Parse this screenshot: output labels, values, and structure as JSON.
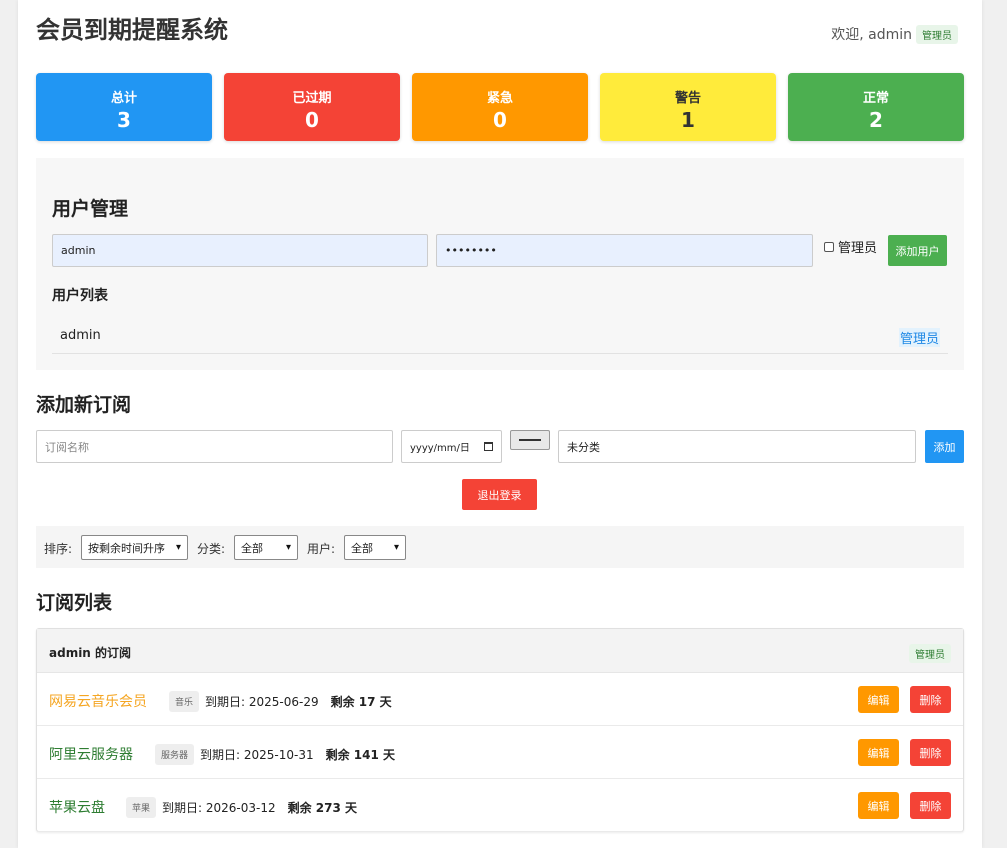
{
  "header": {
    "title": "会员到期提醒系统",
    "welcome": "欢迎, admin",
    "role_badge": "管理员"
  },
  "stats": [
    {
      "label": "总计",
      "value": "3",
      "color": "#2196f3"
    },
    {
      "label": "已过期",
      "value": "0",
      "color": "#f44336"
    },
    {
      "label": "紧急",
      "value": "0",
      "color": "#ff9800"
    },
    {
      "label": "警告",
      "value": "1",
      "color": "#ffeb3b"
    },
    {
      "label": "正常",
      "value": "2",
      "color": "#4caf50"
    }
  ],
  "user_mgmt": {
    "title": "用户管理",
    "username_value": "admin",
    "password_value": "••••••••",
    "admin_checkbox_label": "管理员",
    "add_button": "添加用户",
    "list_title": "用户列表",
    "users": [
      {
        "name": "admin",
        "role": "管理员"
      }
    ]
  },
  "add_sub": {
    "title": "添加新订阅",
    "name_placeholder": "订阅名称",
    "date_placeholder": "yyyy/mm/日",
    "color_button": "",
    "category_value": "未分类",
    "add_button": "添加"
  },
  "logout_button": "退出登录",
  "filters": {
    "sort_label": "排序:",
    "sort_value": "按剩余时间升序",
    "category_label": "分类:",
    "category_value": "全部",
    "user_label": "用户:",
    "user_value": "全部"
  },
  "list": {
    "title": "订阅列表",
    "owner_heading": "admin 的订阅",
    "owner_badge": "管理员",
    "items": [
      {
        "name": "网易云音乐会员",
        "name_color": "#f5a623",
        "tag": "音乐",
        "expiry": "到期日: 2025-06-29",
        "remaining": "剩余 17 天",
        "edit": "编辑",
        "delete": "删除"
      },
      {
        "name": "阿里云服务器",
        "name_color": "#2e7d32",
        "tag": "服务器",
        "expiry": "到期日: 2025-10-31",
        "remaining": "剩余 141 天",
        "edit": "编辑",
        "delete": "删除"
      },
      {
        "name": "苹果云盘",
        "name_color": "#2e7d32",
        "tag": "苹果",
        "expiry": "到期日: 2026-03-12",
        "remaining": "剩余 273 天",
        "edit": "编辑",
        "delete": "删除"
      }
    ]
  }
}
